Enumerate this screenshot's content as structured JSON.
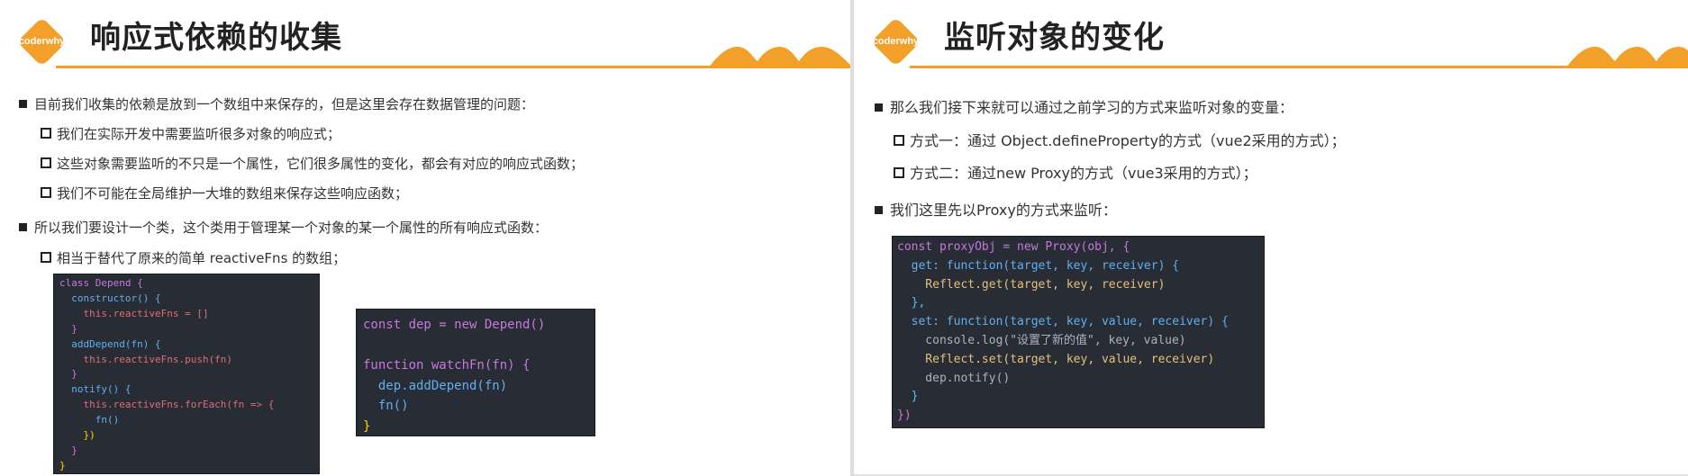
{
  "left": {
    "logo_text": "coderwhy",
    "title": "响应式依赖的收集",
    "bullets": [
      "目前我们收集的依赖是放到一个数组中来保存的，但是这里会存在数据管理的问题：",
      "我们在实际开发中需要监听很多对象的响应式；",
      "这些对象需要监听的不只是一个属性，它们很多属性的变化，都会有对应的响应式函数；",
      "我们不可能在全局维护一大堆的数组来保存这些响应函数；",
      "所以我们要设计一个类，这个类用于管理某一个对象的某一个属性的所有响应式函数：",
      "相当于替代了原来的简单 reactiveFns 的数组；"
    ],
    "code1": [
      "class Depend {",
      "  constructor() {",
      "    this.reactiveFns = []",
      "  }",
      "  addDepend(fn) {",
      "    this.reactiveFns.push(fn)",
      "  }",
      "  notify() {",
      "    this.reactiveFns.forEach(fn => {",
      "      fn()",
      "    })",
      "  }",
      "}"
    ],
    "code2": [
      "const dep = new Depend()",
      "",
      "function watchFn(fn) {",
      "  dep.addDepend(fn)",
      "  fn()",
      "}"
    ]
  },
  "right": {
    "logo_text": "coderwhy",
    "title": "监听对象的变化",
    "bullets": [
      "那么我们接下来就可以通过之前学习的方式来监听对象的变量：",
      "方式一：通过 Object.defineProperty的方式（vue2采用的方式）；",
      "方式二：通过new Proxy的方式（vue3采用的方式）；",
      "我们这里先以Proxy的方式来监听："
    ],
    "code": [
      "const proxyObj = new Proxy(obj, {",
      "  get: function(target, key, receiver) {",
      "    Reflect.get(target, key, receiver)",
      "  },",
      "  set: function(target, key, value, receiver) {",
      "    console.log(\"设置了新的值\", key, value)",
      "    Reflect.set(target, key, value, receiver)",
      "    dep.notify()",
      "  }",
      "})"
    ]
  },
  "colors": {
    "accent": "#f3a02a",
    "code_bg": "#282c34",
    "keyword": "#c678dd",
    "class_name": "#e5c07b",
    "property": "#e06c75",
    "function": "#61afef",
    "string": "#98c379"
  },
  "icons": {
    "logo": "orange-diamond-logo",
    "bullet_level1": "filled-square",
    "bullet_level2": "hollow-square",
    "decoration": "orange-mountain-waves"
  }
}
